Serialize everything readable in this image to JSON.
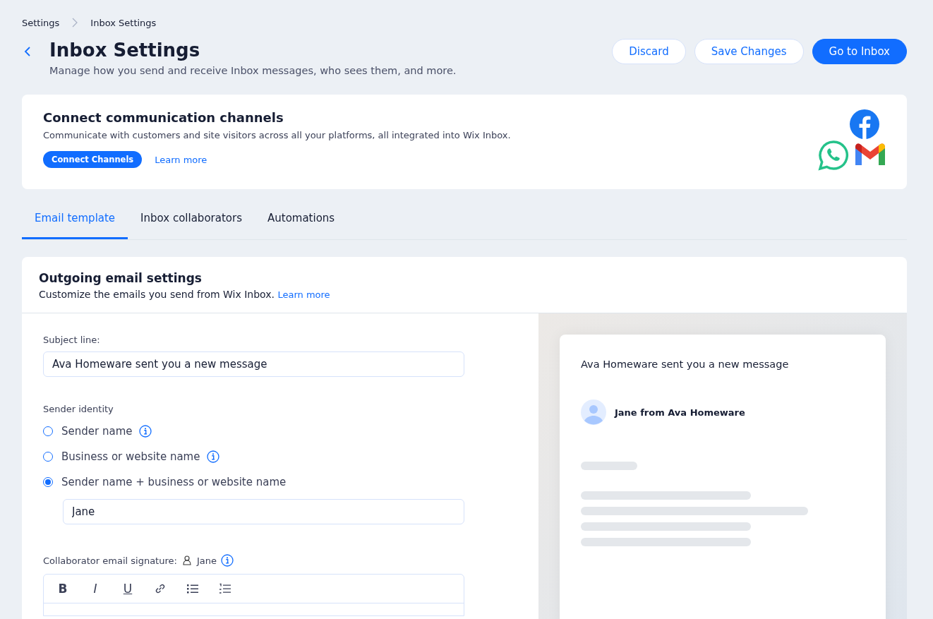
{
  "breadcrumb": [
    "Settings",
    "Inbox Settings"
  ],
  "header": {
    "title": "Inbox Settings",
    "subtitle": "Manage how you send and receive Inbox messages, who sees them, and more.",
    "buttons": [
      {
        "label": "Discard",
        "kind": "secondary"
      },
      {
        "label": "Save Changes",
        "kind": "secondary"
      },
      {
        "label": "Go to Inbox",
        "kind": "primary"
      }
    ]
  },
  "channels_card": {
    "title": "Connect communication channels",
    "description": "Communicate with customers and site visitors across all your platforms, all integrated into Wix Inbox.",
    "button": "Connect Channels",
    "link": "Learn more"
  },
  "tabs": [
    {
      "label": "Email template",
      "selected": true
    },
    {
      "label": "Inbox collaborators",
      "selected": false
    },
    {
      "label": "Automations",
      "selected": false
    }
  ],
  "outgoing": {
    "title": "Outgoing email settings",
    "description": "Customize the emails you send from Wix Inbox.",
    "link": "Learn more",
    "subject_label": "Subject line:",
    "subject_value": "Ava Homeware sent you a new message",
    "sender_label": "Sender identity",
    "options": [
      {
        "label": "Sender name",
        "selected": false,
        "info": true
      },
      {
        "label": "Business or website name",
        "selected": false,
        "info": true
      },
      {
        "label": "Sender name + business or website name",
        "selected": true,
        "info": false
      }
    ],
    "sender_name_value": "Jane",
    "signature_label": "Collaborator email signature:",
    "signature_user": "Jane",
    "toolbar": [
      {
        "kind": "bold",
        "label": "B"
      },
      {
        "kind": "italic",
        "label": "I"
      },
      {
        "kind": "underline",
        "label": "U"
      },
      {
        "kind": "link"
      },
      {
        "kind": "bullets"
      },
      {
        "kind": "numbers"
      }
    ]
  },
  "preview": {
    "subject": "Ava Homeware sent you a new message",
    "sender": "Jane from Ava Homeware"
  }
}
